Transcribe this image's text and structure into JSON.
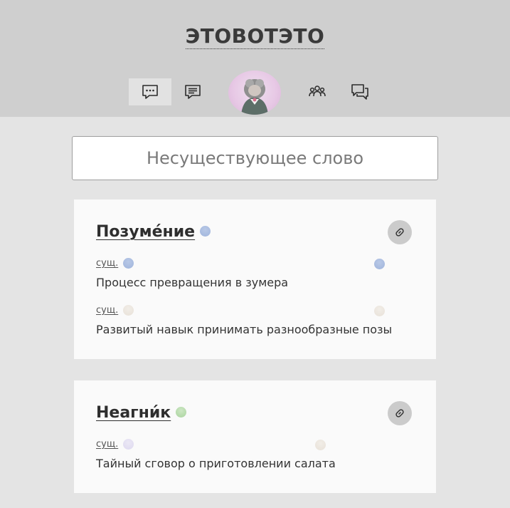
{
  "header": {
    "title": "ЭТОВОТЭТО",
    "nav": [
      {
        "name": "chat",
        "icon": "chat-bubble-dots-icon",
        "active": true
      },
      {
        "name": "articles",
        "icon": "document-lines-icon",
        "active": false
      },
      {
        "name": "profile",
        "icon": "avatar-icon",
        "active": false
      },
      {
        "name": "people",
        "icon": "group-people-icon",
        "active": false
      },
      {
        "name": "discussions",
        "icon": "speech-bubbles-icon",
        "active": false
      }
    ]
  },
  "search": {
    "value": "",
    "placeholder": "Несуществующее слово"
  },
  "cards": [
    {
      "word": "Позуме́ние",
      "word_dot_color": "#a9bde0",
      "link_icon": "link-icon",
      "senses": [
        {
          "pos": "сущ.",
          "pos_dot_color": "#a9bde0",
          "right_dot_color": "#a9bde0",
          "definition": "Процесс превращения в зумера"
        },
        {
          "pos": "сущ.",
          "pos_dot_color": "#ece6de",
          "right_dot_color": "#ece6de",
          "definition": "Развитый навык принимать разнообразные позы"
        }
      ]
    },
    {
      "word": "Неагни́к",
      "word_dot_color": "#b8dcae",
      "link_icon": "link-icon",
      "senses": [
        {
          "pos": "сущ.",
          "pos_dot_color": "#e2def2",
          "right_dot_color": "#ece6de",
          "definition": "Тайный сговор о приготовлении салата"
        }
      ]
    }
  ]
}
